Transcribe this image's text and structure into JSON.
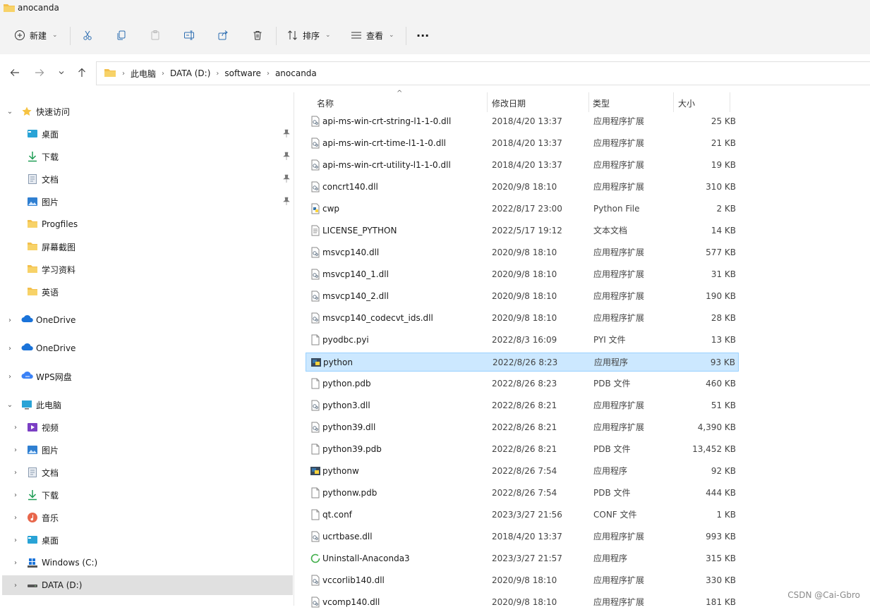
{
  "window": {
    "title": "anocanda"
  },
  "toolbar": {
    "new_label": "新建",
    "sort_label": "排序",
    "view_label": "查看",
    "more_label": "···"
  },
  "address": {
    "crumbs": [
      "此电脑",
      "DATA (D:)",
      "software",
      "anocanda"
    ]
  },
  "sidebar": {
    "quick_access": "快速访问",
    "quick_items": [
      "桌面",
      "下载",
      "文档",
      "图片",
      "Progfiles",
      "屏幕截图",
      "学习资料",
      "英语"
    ],
    "onedrive1": "OneDrive",
    "onedrive2": "OneDrive",
    "wps": "WPS网盘",
    "this_pc": "此电脑",
    "pc_items": [
      "视频",
      "图片",
      "文档",
      "下载",
      "音乐",
      "桌面",
      "Windows (C:)",
      "DATA (D:)"
    ]
  },
  "columns": {
    "name": "名称",
    "date": "修改日期",
    "type": "类型",
    "size": "大小"
  },
  "files": [
    {
      "name": "api-ms-win-crt-string-l1-1-0.dll",
      "date": "2018/4/20 13:37",
      "type": "应用程序扩展",
      "size": "25 KB",
      "icon": "dll-icon"
    },
    {
      "name": "api-ms-win-crt-time-l1-1-0.dll",
      "date": "2018/4/20 13:37",
      "type": "应用程序扩展",
      "size": "21 KB",
      "icon": "dll-icon"
    },
    {
      "name": "api-ms-win-crt-utility-l1-1-0.dll",
      "date": "2018/4/20 13:37",
      "type": "应用程序扩展",
      "size": "19 KB",
      "icon": "dll-icon"
    },
    {
      "name": "concrt140.dll",
      "date": "2020/9/8 18:10",
      "type": "应用程序扩展",
      "size": "310 KB",
      "icon": "dll-icon"
    },
    {
      "name": "cwp",
      "date": "2022/8/17 23:00",
      "type": "Python File",
      "size": "2 KB",
      "icon": "python-file-icon"
    },
    {
      "name": "LICENSE_PYTHON",
      "date": "2022/5/17 19:12",
      "type": "文本文档",
      "size": "14 KB",
      "icon": "text-file-icon"
    },
    {
      "name": "msvcp140.dll",
      "date": "2020/9/8 18:10",
      "type": "应用程序扩展",
      "size": "577 KB",
      "icon": "dll-icon"
    },
    {
      "name": "msvcp140_1.dll",
      "date": "2020/9/8 18:10",
      "type": "应用程序扩展",
      "size": "31 KB",
      "icon": "dll-icon"
    },
    {
      "name": "msvcp140_2.dll",
      "date": "2020/9/8 18:10",
      "type": "应用程序扩展",
      "size": "190 KB",
      "icon": "dll-icon"
    },
    {
      "name": "msvcp140_codecvt_ids.dll",
      "date": "2020/9/8 18:10",
      "type": "应用程序扩展",
      "size": "28 KB",
      "icon": "dll-icon"
    },
    {
      "name": "pyodbc.pyi",
      "date": "2022/8/3 16:09",
      "type": "PYI 文件",
      "size": "13 KB",
      "icon": "blank-file-icon"
    },
    {
      "name": "python",
      "date": "2022/8/26 8:23",
      "type": "应用程序",
      "size": "93 KB",
      "icon": "python-exe-icon",
      "selected": true
    },
    {
      "name": "python.pdb",
      "date": "2022/8/26 8:23",
      "type": "PDB 文件",
      "size": "460 KB",
      "icon": "blank-file-icon"
    },
    {
      "name": "python3.dll",
      "date": "2022/8/26 8:21",
      "type": "应用程序扩展",
      "size": "51 KB",
      "icon": "dll-icon"
    },
    {
      "name": "python39.dll",
      "date": "2022/8/26 8:21",
      "type": "应用程序扩展",
      "size": "4,390 KB",
      "icon": "dll-icon"
    },
    {
      "name": "python39.pdb",
      "date": "2022/8/26 8:21",
      "type": "PDB 文件",
      "size": "13,452 KB",
      "icon": "blank-file-icon"
    },
    {
      "name": "pythonw",
      "date": "2022/8/26 7:54",
      "type": "应用程序",
      "size": "92 KB",
      "icon": "python-exe-icon"
    },
    {
      "name": "pythonw.pdb",
      "date": "2022/8/26 7:54",
      "type": "PDB 文件",
      "size": "444 KB",
      "icon": "blank-file-icon"
    },
    {
      "name": "qt.conf",
      "date": "2023/3/27 21:56",
      "type": "CONF 文件",
      "size": "1 KB",
      "icon": "blank-file-icon"
    },
    {
      "name": "ucrtbase.dll",
      "date": "2018/4/20 13:37",
      "type": "应用程序扩展",
      "size": "993 KB",
      "icon": "dll-icon"
    },
    {
      "name": "Uninstall-Anaconda3",
      "date": "2023/3/27 21:57",
      "type": "应用程序",
      "size": "315 KB",
      "icon": "uninstall-icon"
    },
    {
      "name": "vccorlib140.dll",
      "date": "2020/9/8 18:10",
      "type": "应用程序扩展",
      "size": "330 KB",
      "icon": "dll-icon"
    },
    {
      "name": "vcomp140.dll",
      "date": "2020/9/8 18:10",
      "type": "应用程序扩展",
      "size": "181 KB",
      "icon": "dll-icon"
    }
  ],
  "watermark": "CSDN @Cai-Gbro"
}
